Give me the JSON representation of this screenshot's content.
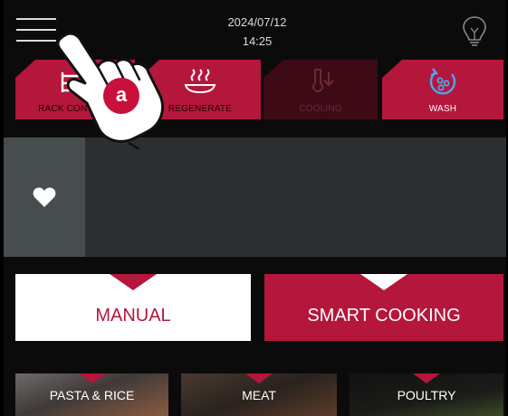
{
  "header": {
    "date": "2024/07/12",
    "time": "14:25",
    "menu_icon": "hamburger-menu-icon",
    "help_icon": "lightbulb-icon"
  },
  "tabs": [
    {
      "label": "RACK CONTROL",
      "icon": "rack-icon",
      "state": "active"
    },
    {
      "label": "REGENERATE",
      "icon": "steam-plate-icon",
      "state": "active"
    },
    {
      "label": "COOLING",
      "icon": "thermometer-down-icon",
      "state": "disabled"
    },
    {
      "label": "WASH",
      "icon": "wash-cycle-icon",
      "state": "active"
    }
  ],
  "favorites": {
    "icon": "heart-icon"
  },
  "modes": {
    "manual": "MANUAL",
    "smart": "SMART COOKING"
  },
  "categories": [
    "PASTA & RICE",
    "MEAT",
    "POULTRY"
  ],
  "tutorial": {
    "badge": "a",
    "icon": "pointing-hand-icon"
  },
  "colors": {
    "accent": "#b5163c",
    "background": "#0b0b0b",
    "panel": "#2b2f31",
    "white": "#ffffff"
  }
}
